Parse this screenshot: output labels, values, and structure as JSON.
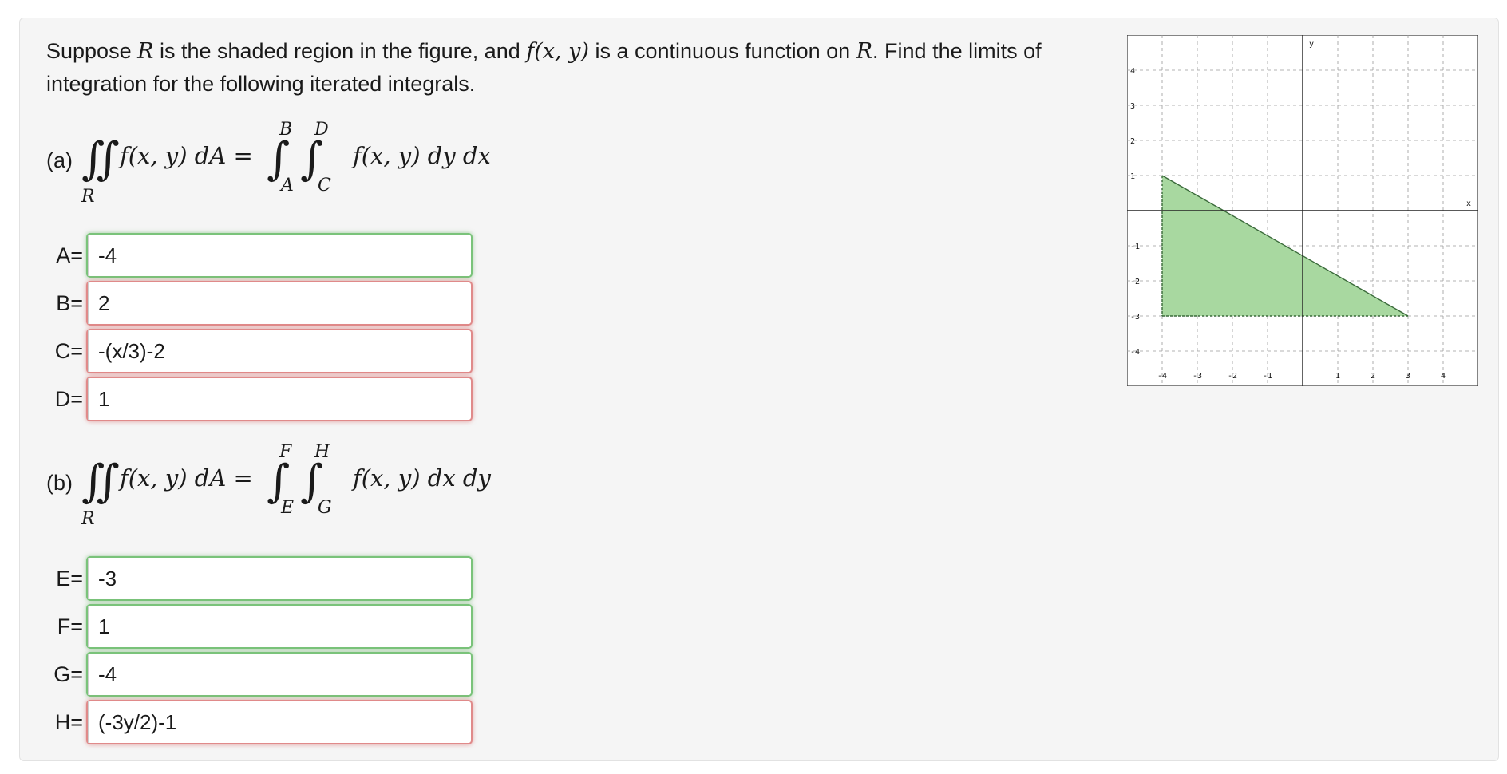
{
  "problem": {
    "intro_1": "Suppose ",
    "intro_R": "R",
    "intro_2": " is the shaded region in the figure, and ",
    "intro_f": "f(x, y)",
    "intro_3": " is a continuous function on ",
    "intro_R2": "R",
    "intro_4": ". Find the limits of integration for the following iterated integrals."
  },
  "part_a": {
    "label": "(a)",
    "double_int": "∬",
    "region": "R",
    "lhs": "f(x, y) dA =",
    "int1": "∫",
    "int2": "∫",
    "upper1": "B",
    "lower1": "A",
    "upper2": "D",
    "lower2": "C",
    "integrand": "f(x, y) dy dx",
    "fields": [
      {
        "label": "A=",
        "value": "-4",
        "status": "correct"
      },
      {
        "label": "B=",
        "value": "2",
        "status": "incorrect"
      },
      {
        "label": "C=",
        "value": "-(x/3)-2",
        "status": "incorrect"
      },
      {
        "label": "D=",
        "value": "1",
        "status": "incorrect"
      }
    ]
  },
  "part_b": {
    "label": "(b)",
    "double_int": "∬",
    "region": "R",
    "lhs": "f(x, y) dA =",
    "int1": "∫",
    "int2": "∫",
    "upper1": "F",
    "lower1": "E",
    "upper2": "H",
    "lower2": "G",
    "integrand": "f(x, y) dx dy",
    "fields": [
      {
        "label": "E=",
        "value": "-3",
        "status": "correct"
      },
      {
        "label": "F=",
        "value": "1",
        "status": "correct"
      },
      {
        "label": "G=",
        "value": "-4",
        "status": "correct"
      },
      {
        "label": "H=",
        "value": "(-3y/2)-1",
        "status": "incorrect"
      }
    ]
  },
  "graph": {
    "x_label": "x",
    "y_label": "y",
    "x_ticks": [
      "-4",
      "-3",
      "-2",
      "-1",
      "1",
      "2",
      "3",
      "4"
    ],
    "y_ticks": [
      "4",
      "3",
      "2",
      "1",
      "-1",
      "-2",
      "-3",
      "-4"
    ],
    "xlim": [
      -5,
      5
    ],
    "ylim": [
      -5,
      5
    ],
    "region_vertices": [
      [
        -4,
        1
      ],
      [
        -4,
        -3
      ],
      [
        3,
        -3
      ]
    ],
    "fill_color": "#a8d8a0",
    "edge_color": "#3a6a3a",
    "grid": true
  },
  "colors": {
    "correct": "#7ac37a",
    "incorrect": "#e08a8a",
    "panel": "#f5f5f5"
  }
}
